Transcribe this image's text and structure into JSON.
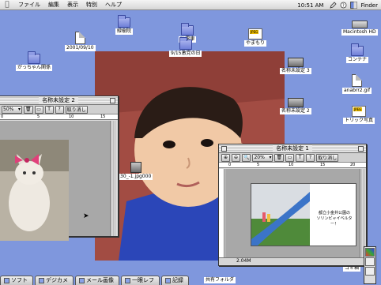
{
  "menubar": {
    "items": [
      "ファイル",
      "編集",
      "表示",
      "特別",
      "ヘルプ"
    ],
    "clock": "10:51 AM",
    "app": "Finder"
  },
  "desktop_icons": {
    "i1": "緑樹院",
    "i2": "N 電車",
    "i3": "2001/09/10",
    "i4": "9/15激党の日",
    "i5": "やまもり",
    "i6": "Macintosh HD",
    "i7": "がっちゃん関係",
    "i8": "名称未設定 3",
    "i9": "コンテナ",
    "i10": "anabrr2.gif",
    "i11": "名称未設定 2",
    "i12": "トリック写真",
    "i13": "30_-1.jpg000",
    "i14": "ゴミ箱",
    "i15": "共有フォルダ",
    "jpeg_badge": "JPEG"
  },
  "window_left": {
    "title": "名称未設定 2",
    "zoom": "50%",
    "undo": "取り消し",
    "ruler": [
      "0",
      "5",
      "10",
      "15"
    ]
  },
  "window_right": {
    "title": "名称未設定 1",
    "zoom": "20%",
    "undo": "取り消し",
    "ruler": [
      "0",
      "5",
      "10",
      "15",
      "20"
    ],
    "status": "2.04M",
    "caption_line1": "都立小金井公園の",
    "caption_line2": "ソリンピャイベルター！"
  },
  "tabbar": {
    "tabs": [
      "ソフト",
      "デジカメ",
      "メール画像",
      "一眼レフ",
      "記録"
    ]
  },
  "colors": {
    "desktop": "#7f97dd",
    "photo_bg": "#a24c43"
  }
}
